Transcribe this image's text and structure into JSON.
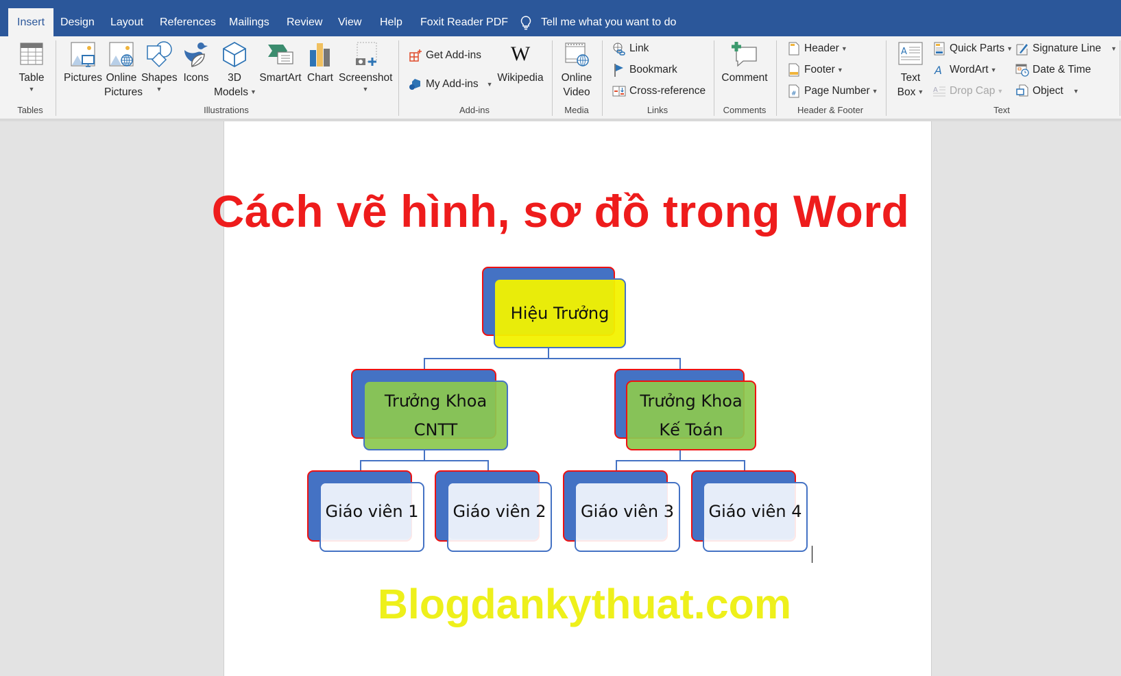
{
  "tabs": [
    {
      "label": "Insert",
      "active": true
    },
    {
      "label": "Design"
    },
    {
      "label": "Layout"
    },
    {
      "label": "References"
    },
    {
      "label": "Mailings"
    },
    {
      "label": "Review"
    },
    {
      "label": "View"
    },
    {
      "label": "Help"
    },
    {
      "label": "Foxit Reader PDF"
    }
  ],
  "tell_me": {
    "icon": "lightbulb-icon",
    "label": "Tell me what you want to do"
  },
  "ribbon": {
    "tables": {
      "group_label": "Tables",
      "table": {
        "label": "Table",
        "icon": "table-icon"
      }
    },
    "illustrations": {
      "group_label": "Illustrations",
      "pictures": {
        "label": "Pictures",
        "icon": "pictures-icon"
      },
      "online_pictures": {
        "label1": "Online",
        "label2": "Pictures",
        "icon": "online-pictures-icon"
      },
      "shapes": {
        "label": "Shapes",
        "icon": "shapes-icon"
      },
      "icons": {
        "label": "Icons",
        "icon": "icons-icon"
      },
      "models": {
        "label1": "3D",
        "label2": "Models",
        "icon": "3d-models-icon"
      },
      "smartart": {
        "label": "SmartArt",
        "icon": "smartart-icon"
      },
      "chart": {
        "label": "Chart",
        "icon": "chart-icon"
      },
      "screenshot": {
        "label": "Screenshot",
        "icon": "screenshot-icon"
      }
    },
    "addins": {
      "group_label": "Add-ins",
      "get_addins": {
        "label": "Get Add-ins",
        "icon": "store-icon"
      },
      "my_addins": {
        "label": "My Add-ins",
        "icon": "addins-icon"
      },
      "wikipedia": {
        "label": "Wikipedia",
        "glyph": "W"
      }
    },
    "media": {
      "group_label": "Media",
      "online_video": {
        "label1": "Online",
        "label2": "Video",
        "icon": "online-video-icon"
      }
    },
    "links": {
      "group_label": "Links",
      "link": {
        "label": "Link",
        "icon": "link-icon"
      },
      "bookmark": {
        "label": "Bookmark",
        "icon": "bookmark-icon"
      },
      "cross_reference": {
        "label": "Cross-reference",
        "icon": "cross-reference-icon"
      }
    },
    "comments": {
      "group_label": "Comments",
      "comment": {
        "label": "Comment",
        "icon": "comment-icon"
      }
    },
    "header_footer": {
      "group_label": "Header & Footer",
      "header": {
        "label": "Header",
        "icon": "header-icon"
      },
      "footer": {
        "label": "Footer",
        "icon": "footer-icon"
      },
      "page_number": {
        "label": "Page Number",
        "icon": "page-number-icon"
      }
    },
    "text": {
      "group_label": "Text",
      "text_box": {
        "label1": "Text",
        "label2": "Box",
        "icon": "text-box-icon"
      },
      "quick_parts": {
        "label": "Quick Parts",
        "icon": "quick-parts-icon"
      },
      "wordart": {
        "label": "WordArt",
        "icon": "wordart-icon"
      },
      "drop_cap": {
        "label": "Drop Cap",
        "icon": "drop-cap-icon",
        "disabled": true
      },
      "signature_line": {
        "label": "Signature Line",
        "icon": "signature-line-icon"
      },
      "date_time": {
        "label": "Date & Time",
        "icon": "date-time-icon"
      },
      "object": {
        "label": "Object",
        "icon": "object-icon"
      }
    }
  },
  "document": {
    "title": "Cách vẽ hình, sơ đồ trong Word",
    "org_chart": {
      "root": {
        "line1": "Hiệu Trưởng"
      },
      "level2": [
        {
          "line1": "Trưởng Khoa",
          "line2": "CNTT"
        },
        {
          "line1": "Trưởng Khoa",
          "line2": "Kế Toán"
        }
      ],
      "level3": [
        {
          "line1": "Giáo viên 1"
        },
        {
          "line1": "Giáo viên 2"
        },
        {
          "line1": "Giáo viên 3"
        },
        {
          "line1": "Giáo viên 4"
        }
      ]
    },
    "watermark": "Blogdankythuat.com"
  },
  "colors": {
    "tabbar": "#2b579a",
    "title_red": "#ee1c1c",
    "watermark_yellow": "#eef01b",
    "box_blue": "#4472c4",
    "box_red_border": "#ee1111",
    "root_yellow": "#f2f200",
    "level2_green": "#8cc850"
  }
}
